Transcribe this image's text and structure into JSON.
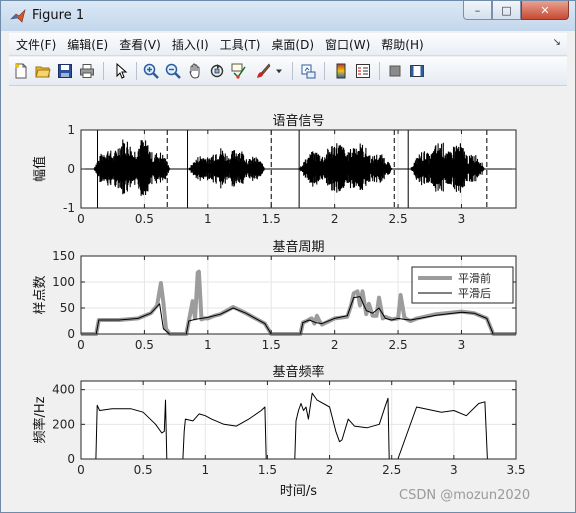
{
  "window": {
    "title": "Figure 1",
    "controls": {
      "minimize": "–",
      "maximize": "□",
      "close": "✕"
    }
  },
  "menu": {
    "items": [
      "文件(F)",
      "编辑(E)",
      "查看(V)",
      "插入(I)",
      "工具(T)",
      "桌面(D)",
      "窗口(W)",
      "帮助(H)"
    ]
  },
  "toolbar": {
    "icons": [
      "new-figure-icon",
      "open-file-icon",
      "save-icon",
      "print-icon",
      "pointer-icon",
      "zoom-in-icon",
      "zoom-out-icon",
      "pan-hand-icon",
      "rotate-3d-icon",
      "data-cursor-icon",
      "brush-icon",
      "link-plot-icon",
      "colorbar-icon",
      "legend-icon",
      "hide-plot-tools-icon",
      "show-plot-tools-icon"
    ]
  },
  "watermark": "CSDN @mozun2020",
  "colors": {
    "signal": "#000000",
    "raw_period": "#9c9c9c",
    "smooth_period": "#000000",
    "grid": "#e6e6e6"
  },
  "chart_data": [
    {
      "type": "line",
      "title": "语音信号",
      "xlabel": "",
      "ylabel": "幅值",
      "xlim": [
        0,
        3.43
      ],
      "ylim": [
        -1,
        1
      ],
      "xticks": [
        0,
        0.5,
        1,
        1.5,
        2,
        2.5,
        3
      ],
      "xtick_labels": [
        "0",
        "0.5",
        "1",
        "1.5",
        "2",
        "2.5",
        "3"
      ],
      "yticks": [
        -1,
        0,
        1
      ],
      "ytick_labels": [
        "-1",
        "0",
        "1"
      ],
      "grid": true,
      "series": [
        {
          "style": "waveform",
          "segments": [
            {
              "start": 0.1,
              "end": 0.7,
              "peak": 0.85
            },
            {
              "start": 0.85,
              "end": 1.45,
              "peak": 0.6
            },
            {
              "start": 1.72,
              "end": 2.45,
              "peak": 0.75
            },
            {
              "start": 2.6,
              "end": 3.18,
              "peak": 0.75
            }
          ]
        }
      ],
      "markers_solid": [
        0.13,
        0.84,
        1.72,
        2.58
      ],
      "markers_dashed": [
        0.68,
        1.5,
        2.47,
        3.2
      ]
    },
    {
      "type": "line",
      "title": "基音周期",
      "xlabel": "",
      "ylabel": "样点数",
      "xlim": [
        0,
        3.43
      ],
      "ylim": [
        0,
        150
      ],
      "xticks": [
        0,
        0.5,
        1,
        1.5,
        2,
        2.5,
        3
      ],
      "xtick_labels": [
        "0",
        "0.5",
        "1",
        "1.5",
        "2",
        "2.5",
        "3"
      ],
      "yticks": [
        0,
        50,
        100,
        150
      ],
      "ytick_labels": [
        "0",
        "50",
        "100",
        "150"
      ],
      "grid": true,
      "legend": {
        "position": "right",
        "entries": [
          "平滑前",
          "平滑后"
        ]
      },
      "series": [
        {
          "name": "平滑前",
          "x": [
            0,
            0.12,
            0.14,
            0.3,
            0.45,
            0.55,
            0.6,
            0.63,
            0.65,
            0.67,
            0.7,
            0.83,
            0.85,
            0.88,
            0.9,
            0.92,
            0.93,
            0.95,
            0.97,
            1.0,
            1.05,
            1.1,
            1.15,
            1.2,
            1.3,
            1.45,
            1.5,
            1.73,
            1.75,
            1.78,
            1.8,
            1.82,
            1.84,
            1.86,
            1.88,
            1.9,
            2.0,
            2.1,
            2.13,
            2.15,
            2.18,
            2.2,
            2.22,
            2.25,
            2.27,
            2.3,
            2.33,
            2.35,
            2.38,
            2.4,
            2.45,
            2.5,
            2.52,
            2.55,
            2.57,
            2.6,
            2.65,
            2.8,
            3.0,
            3.1,
            3.2,
            3.25,
            3.43
          ],
          "y": [
            0,
            0,
            27,
            27,
            30,
            40,
            55,
            98,
            60,
            10,
            0,
            0,
            25,
            63,
            30,
            118,
            120,
            28,
            30,
            30,
            35,
            38,
            45,
            52,
            40,
            20,
            0,
            0,
            22,
            25,
            28,
            30,
            20,
            35,
            25,
            18,
            30,
            33,
            55,
            78,
            82,
            55,
            82,
            38,
            58,
            35,
            35,
            70,
            30,
            33,
            28,
            30,
            75,
            32,
            28,
            25,
            30,
            38,
            43,
            40,
            30,
            0,
            0
          ]
        },
        {
          "name": "平滑后",
          "x": [
            0,
            0.12,
            0.14,
            0.3,
            0.45,
            0.55,
            0.62,
            0.65,
            0.7,
            0.83,
            0.85,
            0.9,
            0.95,
            1.0,
            1.1,
            1.2,
            1.3,
            1.45,
            1.5,
            1.73,
            1.75,
            1.8,
            1.85,
            1.9,
            2.0,
            2.1,
            2.15,
            2.2,
            2.25,
            2.3,
            2.35,
            2.4,
            2.45,
            2.5,
            2.55,
            2.6,
            2.8,
            3.0,
            3.1,
            3.2,
            3.25,
            3.43
          ],
          "y": [
            0,
            0,
            27,
            27,
            30,
            40,
            58,
            10,
            0,
            0,
            25,
            28,
            30,
            32,
            38,
            50,
            40,
            20,
            0,
            0,
            22,
            27,
            22,
            20,
            30,
            35,
            70,
            72,
            45,
            40,
            50,
            30,
            27,
            30,
            28,
            27,
            36,
            42,
            40,
            30,
            0,
            0
          ]
        }
      ]
    },
    {
      "type": "line",
      "title": "基音频率",
      "xlabel": "时间/s",
      "ylabel": "频率/Hz",
      "xlim": [
        0,
        3.5
      ],
      "ylim": [
        0,
        450
      ],
      "xticks": [
        0,
        0.5,
        1,
        1.5,
        2,
        2.5,
        3,
        3.5
      ],
      "xtick_labels": [
        "0",
        "0.5",
        "1",
        "1.5",
        "2",
        "2.5",
        "3",
        "3.5"
      ],
      "yticks": [
        0,
        200,
        400
      ],
      "ytick_labels": [
        "0",
        "200",
        "400"
      ],
      "grid": true,
      "series": [
        {
          "name": "",
          "x": [
            0,
            0.12,
            0.13,
            0.15,
            0.25,
            0.4,
            0.5,
            0.6,
            0.65,
            0.67,
            0.68,
            0.69,
            0.7,
            0.82,
            0.83,
            0.84,
            0.9,
            0.95,
            1.0,
            1.05,
            1.15,
            1.25,
            1.35,
            1.45,
            1.48,
            1.49,
            1.5,
            1.72,
            1.73,
            1.75,
            1.77,
            1.79,
            1.81,
            1.83,
            1.86,
            1.9,
            2.0,
            2.05,
            2.08,
            2.1,
            2.15,
            2.2,
            2.3,
            2.4,
            2.45,
            2.47,
            2.48,
            2.49,
            2.55,
            2.7,
            2.9,
            3.0,
            3.1,
            3.2,
            3.25,
            3.27,
            3.5
          ],
          "y": [
            0,
            0,
            310,
            280,
            290,
            290,
            270,
            200,
            150,
            160,
            340,
            0,
            0,
            0,
            160,
            230,
            220,
            260,
            250,
            230,
            200,
            190,
            230,
            280,
            300,
            0,
            0,
            0,
            220,
            280,
            320,
            280,
            300,
            230,
            380,
            340,
            300,
            160,
            100,
            110,
            230,
            190,
            180,
            200,
            310,
            350,
            0,
            0,
            0,
            300,
            270,
            280,
            250,
            320,
            330,
            0,
            0
          ]
        }
      ]
    }
  ]
}
